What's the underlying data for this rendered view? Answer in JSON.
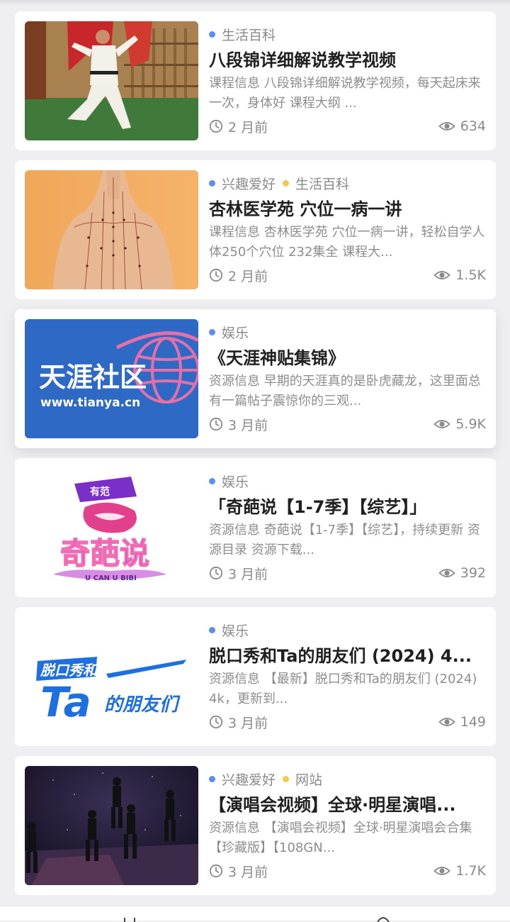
{
  "colors": {
    "background": "#efeff1",
    "card": "#ffffff",
    "title": "#1f1f1f",
    "muted": "#8a8a8a",
    "tag_dot_blue": "#5b8ef0",
    "tag_dot_yellow": "#f2c94c"
  },
  "cards": [
    {
      "tags": [
        {
          "label": "生活百科",
          "dot": "blue"
        }
      ],
      "title": "八段锦详细解说教学视频",
      "desc": "课程信息 八段锦详细解说教学视频，每天起床来一次，身体好 课程大纲 ...",
      "time": "2 月前",
      "views": "634",
      "thumb_icon": "martial-arts-photo"
    },
    {
      "tags": [
        {
          "label": "兴趣爱好",
          "dot": "blue"
        },
        {
          "label": "生活百科",
          "dot": "yellow"
        }
      ],
      "title": "杏林医学苑 穴位一病一讲",
      "desc": "课程信息 杏林医学苑 穴位一病一讲，轻松自学人体250个穴位 232集全 课程大...",
      "time": "2 月前",
      "views": "1.5K",
      "thumb_icon": "acupuncture-photo"
    },
    {
      "tags": [
        {
          "label": "娱乐",
          "dot": "blue"
        }
      ],
      "title": "《天涯神贴集锦》",
      "desc": " 资源信息 早期的天涯真的是卧虎藏龙，这里面总有一篇帖子震惊你的三观...",
      "time": "3 月前",
      "views": "5.9K",
      "thumb_icon": "tianya-logo",
      "thumb_text": {
        "name": "天涯社区",
        "url": "www.tianya.cn"
      }
    },
    {
      "tags": [
        {
          "label": "娱乐",
          "dot": "blue"
        }
      ],
      "title": "「奇葩说【1-7季】【综艺】」",
      "desc": " 资源信息 奇葩说【1-7季】【综艺】，持续更新 资源目录 资源下载...",
      "time": "3 月前",
      "views": "392",
      "thumb_icon": "qipashuo-logo",
      "thumb_text": {
        "name": "奇葩说",
        "badge": "有范",
        "sub": "U CAN U BIBI"
      }
    },
    {
      "tags": [
        {
          "label": "娱乐",
          "dot": "blue"
        }
      ],
      "title": "脱口秀和Ta的朋友们 (2024) 4...",
      "desc": " 资源信息 【最新】脱口秀和Ta的朋友们 (2024) 4k，更新到...",
      "time": "3 月前",
      "views": "149",
      "thumb_icon": "talk-show-logo",
      "thumb_text": {
        "line1": "脱口秀和",
        "big": "Ta",
        "line2": "的朋友们"
      }
    },
    {
      "tags": [
        {
          "label": "兴趣爱好",
          "dot": "blue"
        },
        {
          "label": "网站",
          "dot": "yellow"
        }
      ],
      "title": "【演唱会视频】全球·明星演唱...",
      "desc": " 资源信息 【演唱会视频】全球·明星演唱会合集【珍藏版】【108GN...",
      "time": "3 月前",
      "views": "1.7K",
      "thumb_icon": "concert-photo"
    }
  ]
}
